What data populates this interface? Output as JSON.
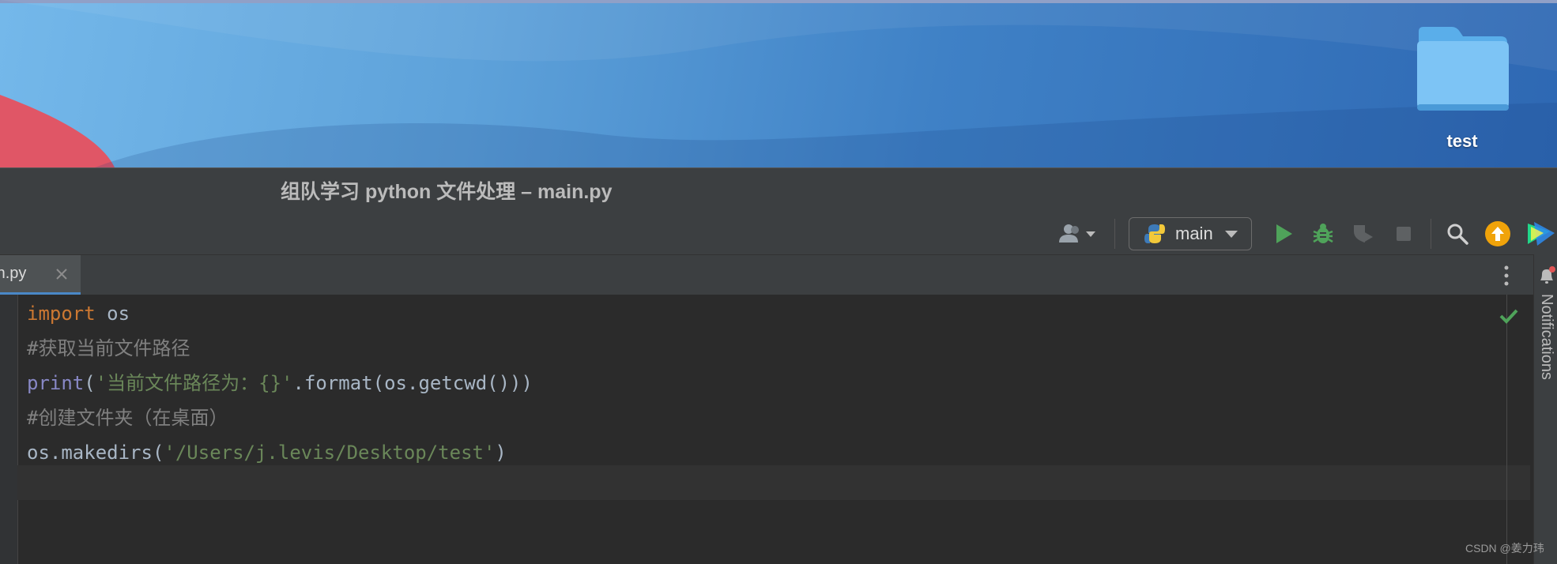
{
  "desktop": {
    "folder_label": "test"
  },
  "window": {
    "title": "组队学习 python 文件处理 – main.py"
  },
  "toolbar": {
    "vcs_user_icon": "user-icon",
    "run_config": "main",
    "run_icon": "play-icon",
    "debug_icon": "bug-icon",
    "coverage_icon": "coverage-icon",
    "stop_icon": "stop-icon",
    "search_icon": "search-icon",
    "update_icon": "arrow-up-icon",
    "accent_run": "#4fa35a",
    "accent_update": "#f0a30a"
  },
  "tabs": [
    {
      "label": "ain.py",
      "active": true
    }
  ],
  "side": {
    "notifications_label": "Notifications"
  },
  "editor": {
    "lines": [
      {
        "kw": "import",
        "rest": " os"
      },
      {
        "comment": "#获取当前文件路径"
      },
      {
        "fn": "print",
        "open": "(",
        "str": "'当前文件路径为：{}'",
        "rest": ".format(os.getcwd()))"
      },
      {
        "comment": "#创建文件夹（在桌面）"
      },
      {
        "prefix": "os.makedirs(",
        "str": "'/Users/j.levis/Desktop/test'",
        "rest": ")"
      }
    ]
  },
  "watermark": "CSDN @姜力玮"
}
